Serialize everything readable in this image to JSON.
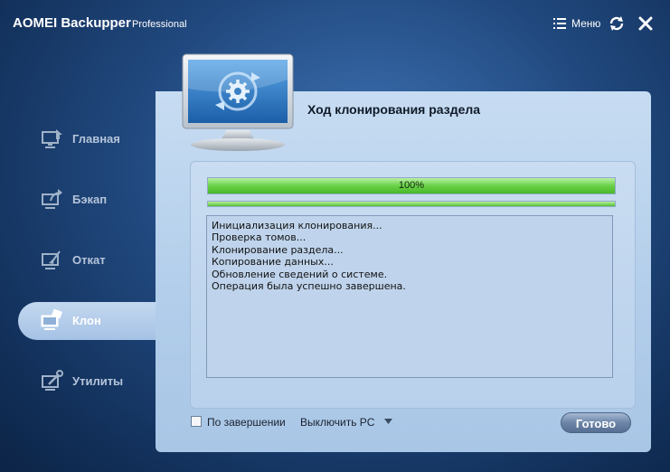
{
  "app": {
    "name": "AOMEI Backupper",
    "edition": "Professional"
  },
  "titlebar": {
    "menu_label": "Меню"
  },
  "sidebar": {
    "items": [
      {
        "label": "Главная",
        "icon": "home-monitor-icon"
      },
      {
        "label": "Бэкап",
        "icon": "backup-arrow-icon"
      },
      {
        "label": "Откат",
        "icon": "restore-icon"
      },
      {
        "label": "Клон",
        "icon": "clone-icon"
      },
      {
        "label": "Утилиты",
        "icon": "tools-icon"
      }
    ],
    "active_index": 3
  },
  "panel": {
    "title": "Ход клонирования раздела",
    "progress": {
      "value": 100,
      "text": "100%"
    },
    "log": [
      "Инициализация клонирования...",
      "Проверка томов...",
      "Клонирование раздела...",
      "Копирование данных...",
      "Обновление сведений о системе.",
      "Операция была успешно завершена."
    ]
  },
  "footer": {
    "on_complete_label": "По завершении",
    "on_complete_checked": false,
    "action_value": "Выключить PC",
    "done_label": "Готово"
  },
  "colors": {
    "accent_blue": "#3f74b6",
    "progress_green": "#69d146",
    "panel_bg": "#c7dcf2"
  }
}
